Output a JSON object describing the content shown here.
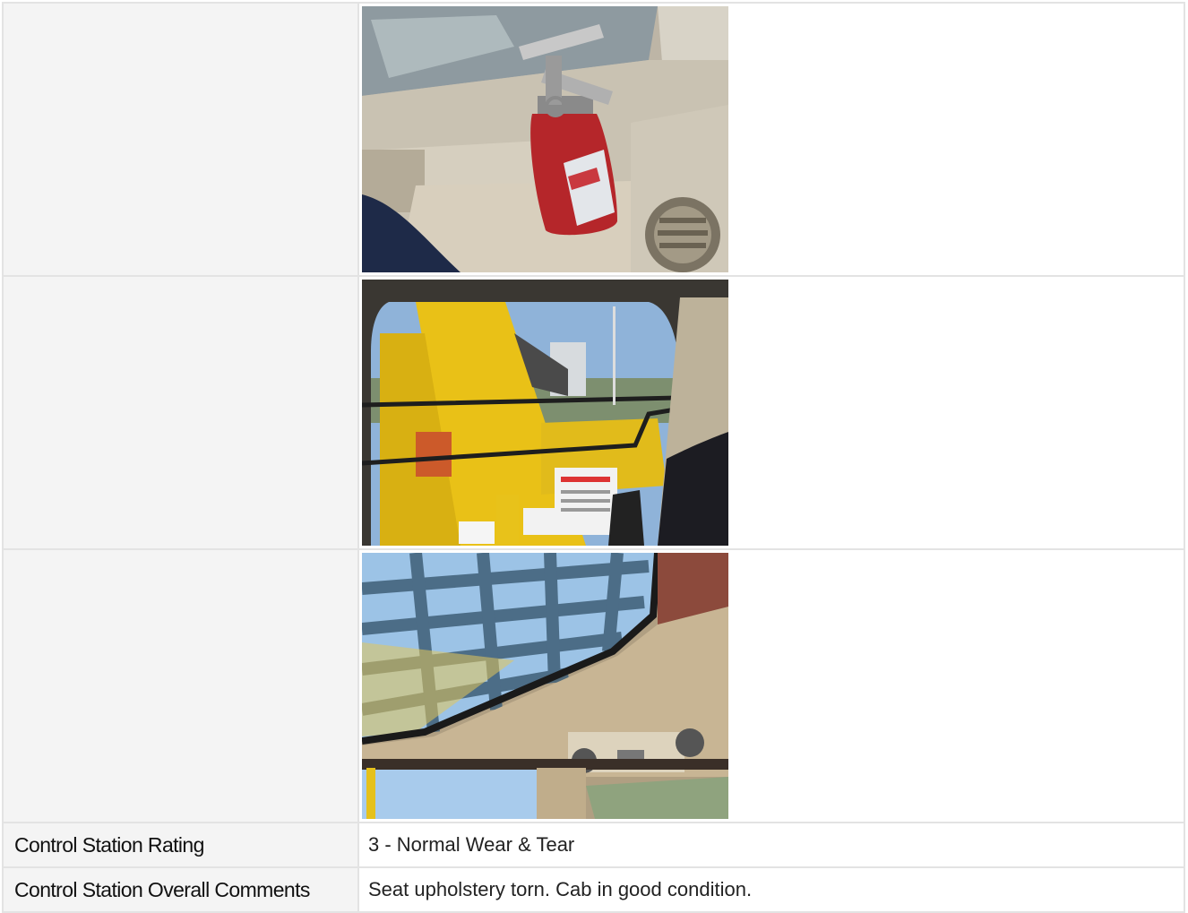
{
  "photos": [
    {
      "subject": "fire-extinguisher-photo"
    },
    {
      "subject": "cab-front-window-photo"
    },
    {
      "subject": "cab-roof-window-photo"
    }
  ],
  "fields": [
    {
      "label": "Control Station Rating",
      "value": "3 - Normal Wear & Tear"
    },
    {
      "label": "Control Station Overall Comments",
      "value": "Seat upholstery torn. Cab in good condition."
    }
  ]
}
